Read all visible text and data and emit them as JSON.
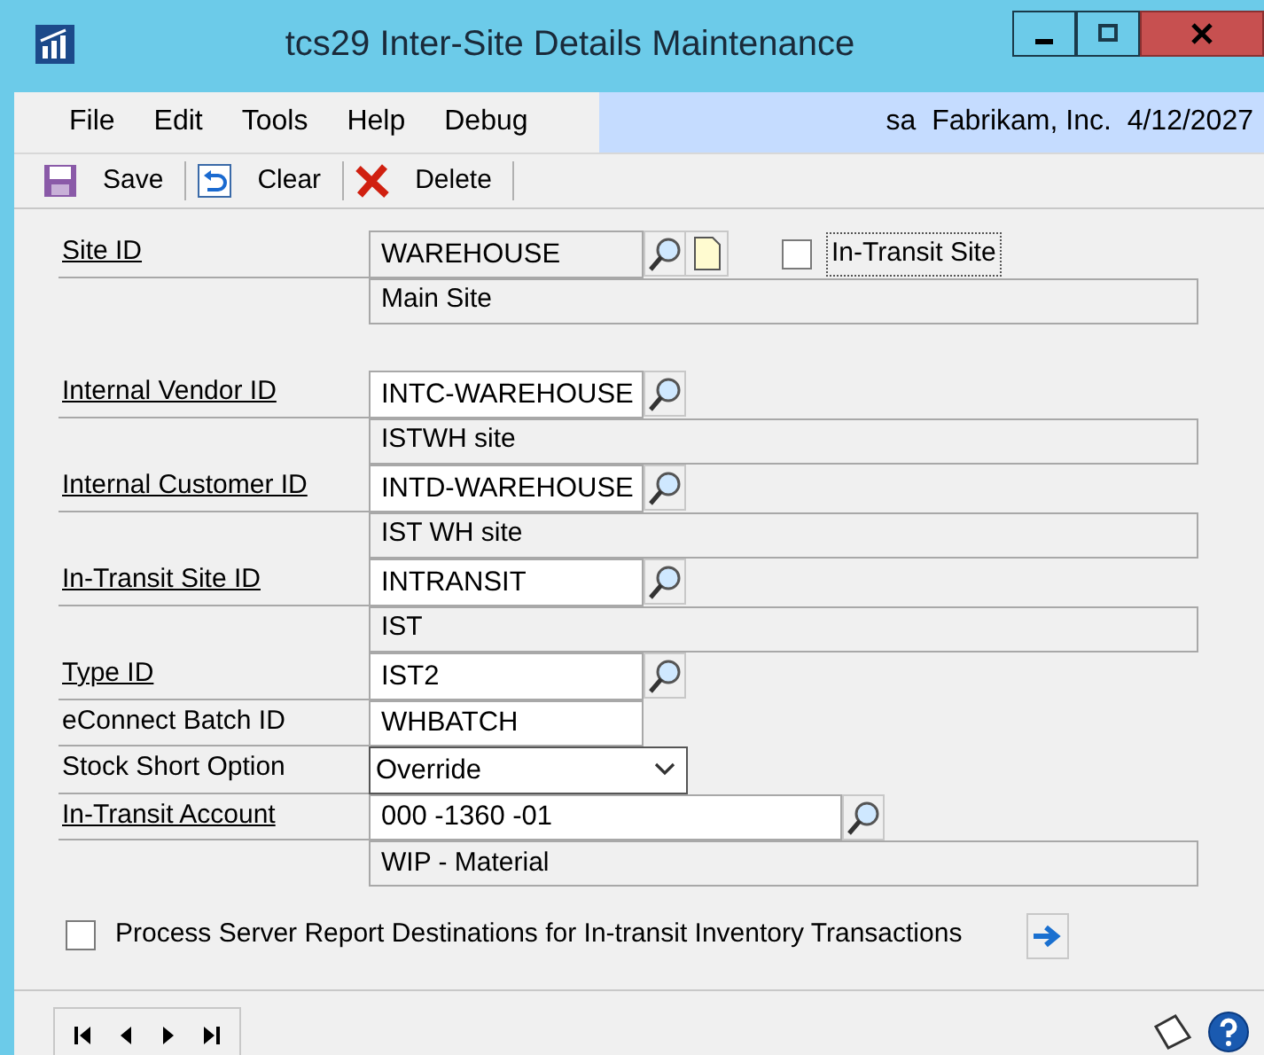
{
  "window": {
    "title": "tcs29 Inter-Site Details Maintenance"
  },
  "menu": [
    "File",
    "Edit",
    "Tools",
    "Help",
    "Debug"
  ],
  "user_info": "sa  Fabrikam, Inc.  4/12/2027",
  "toolbar": [
    {
      "kind": "save",
      "label": "Save"
    },
    {
      "kind": "clear",
      "label": "Clear"
    },
    {
      "kind": "delete",
      "label": "Delete"
    }
  ],
  "site": {
    "label": "Site ID",
    "link": true,
    "value": "WAREHOUSE",
    "disabled": true,
    "description": "Main Site",
    "in_transit_site": {
      "label": "In-Transit Site",
      "checked": false
    }
  },
  "fields": [
    {
      "label": "Internal Vendor ID",
      "link": true,
      "kind": "lookup",
      "value": "INTC-WAREHOUSE",
      "description": "ISTWH site"
    },
    {
      "label": "Internal Customer ID",
      "link": true,
      "kind": "lookup",
      "value": "INTD-WAREHOUSE",
      "description": "IST WH site"
    },
    {
      "label": "In-Transit Site ID",
      "link": true,
      "kind": "lookup",
      "value": "INTRANSIT",
      "description": "IST"
    },
    {
      "label": "Type ID",
      "link": true,
      "kind": "lookup",
      "value": "IST2"
    },
    {
      "label": "eConnect Batch ID",
      "link": false,
      "kind": "text",
      "value": "WHBATCH"
    },
    {
      "label": "Stock Short  Option",
      "link": false,
      "kind": "dropdown",
      "value": "Override"
    },
    {
      "label": "In-Transit Account",
      "link": true,
      "kind": "account",
      "value": "000 -1360 -01",
      "description": "WIP - Material"
    }
  ],
  "process_option": {
    "label": "Process Server Report Destinations for In-transit Inventory Transactions",
    "checked": false
  }
}
